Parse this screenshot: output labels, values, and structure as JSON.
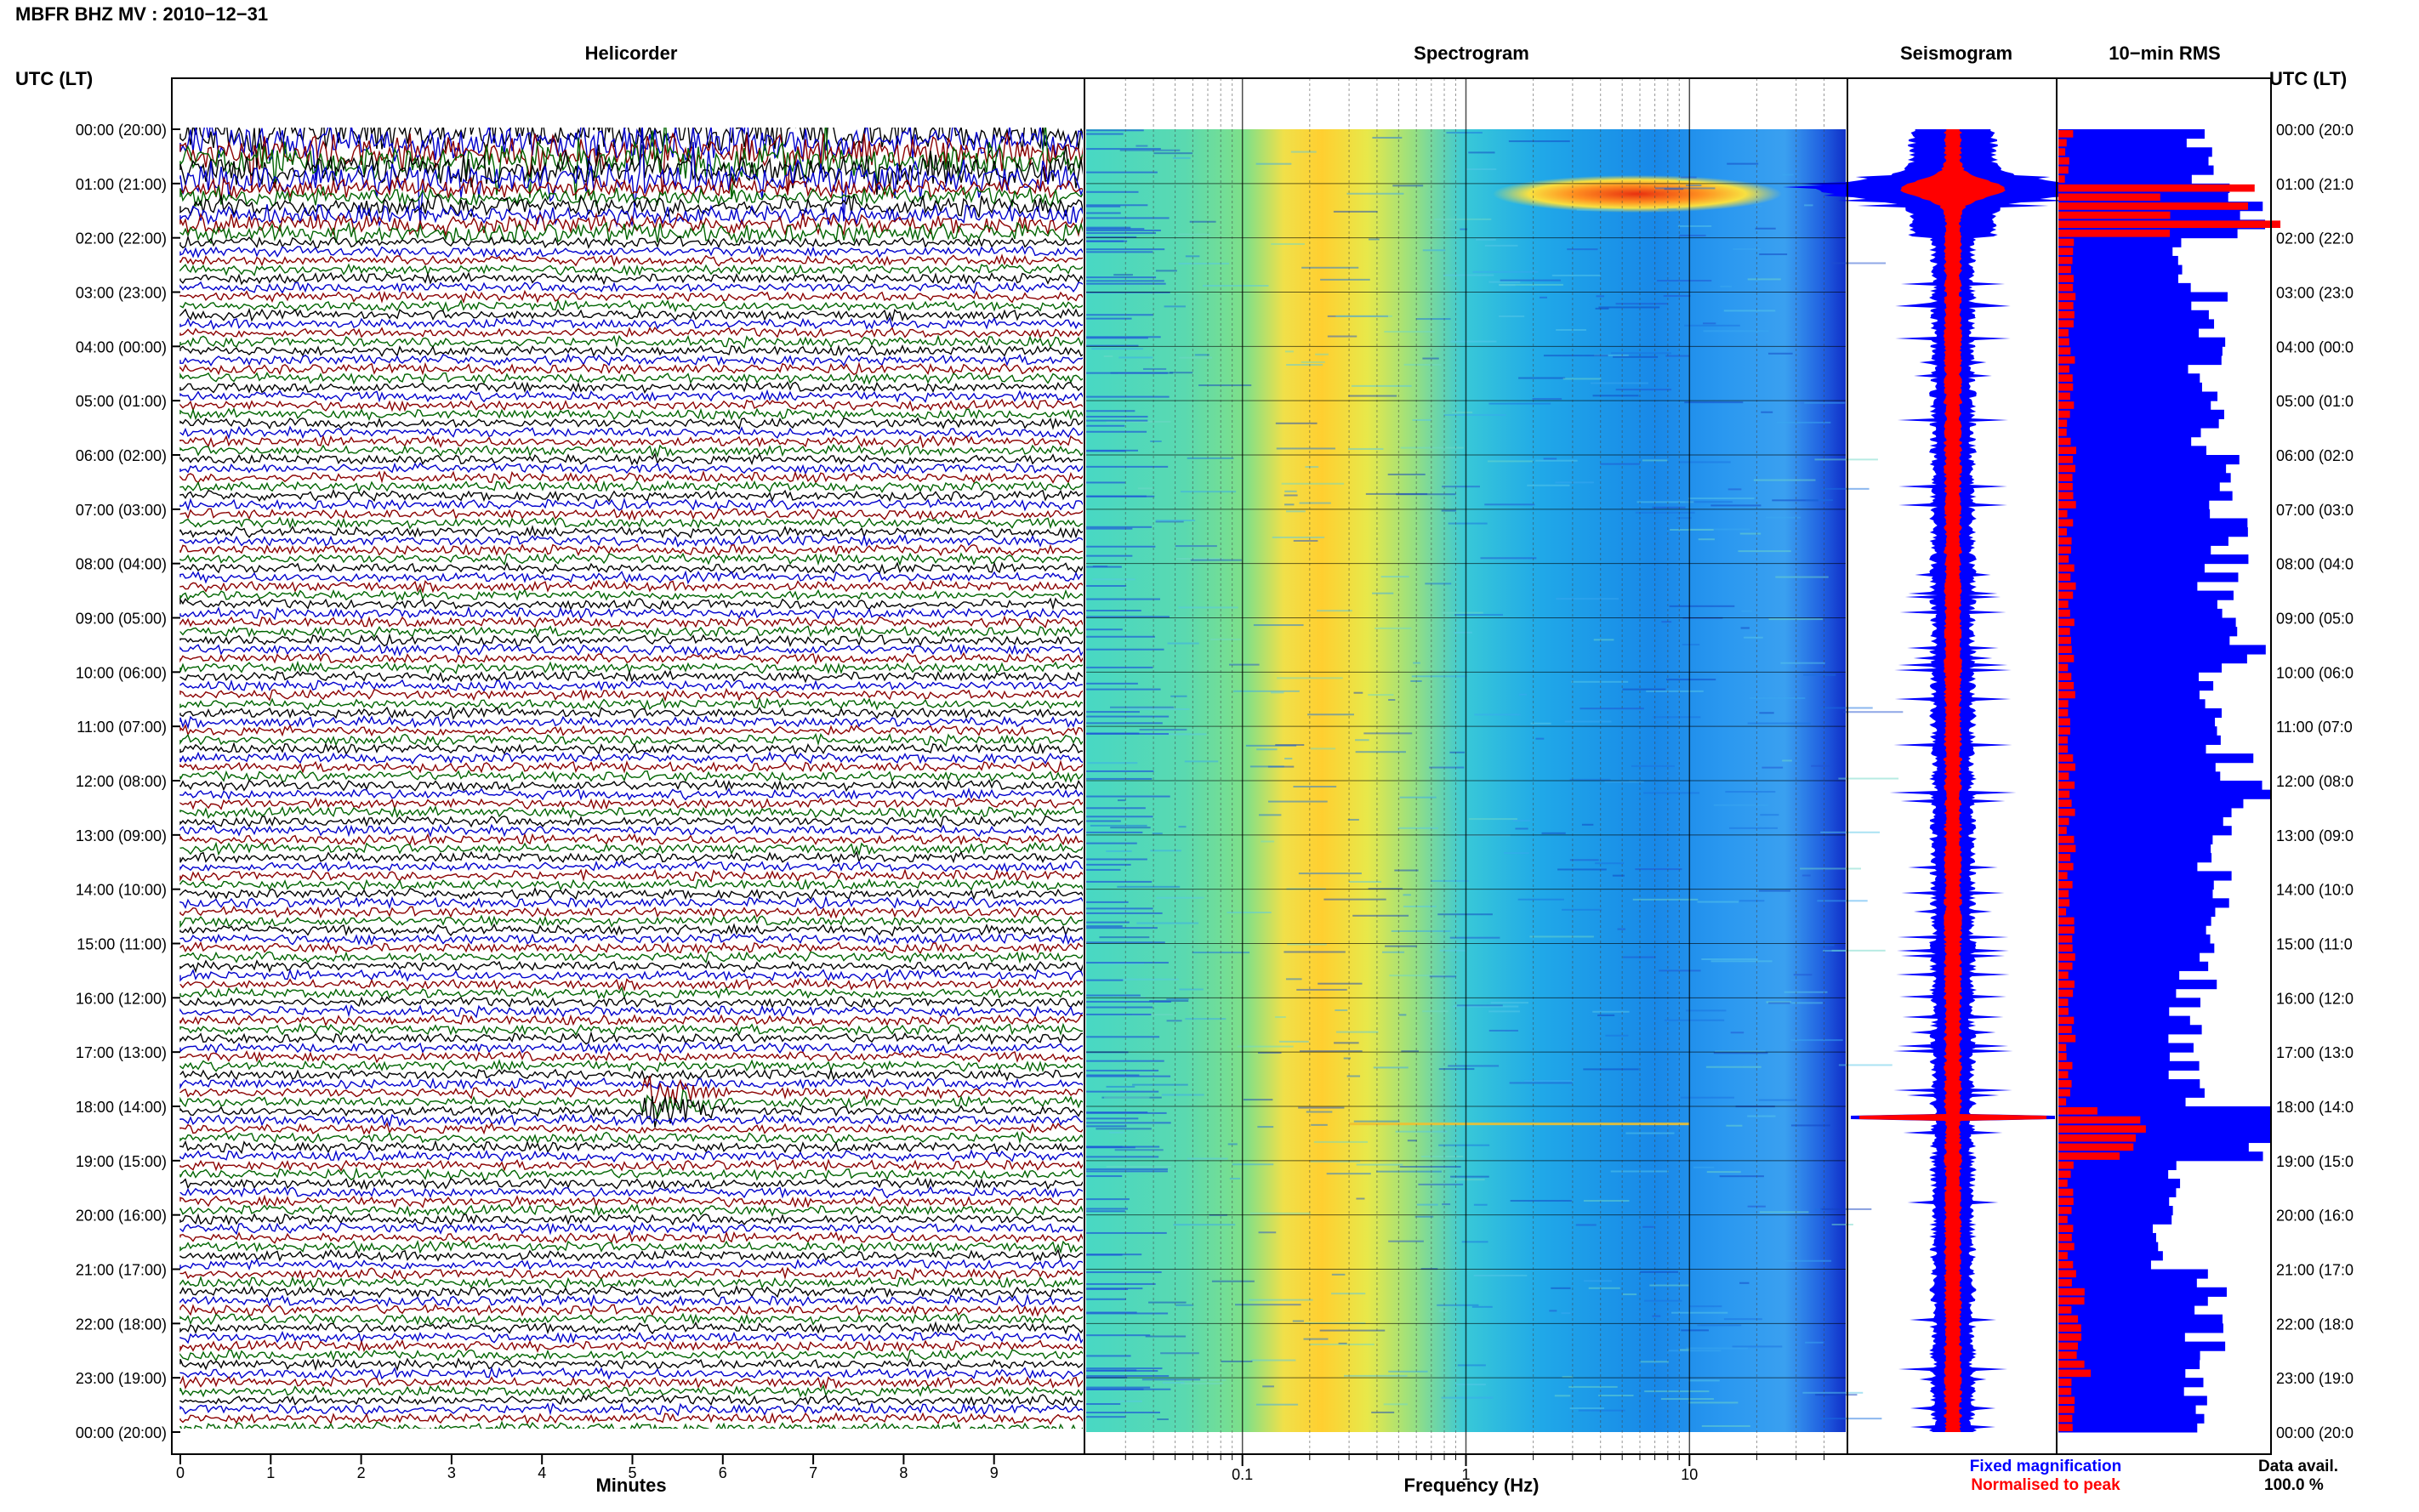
{
  "title": "MBFR BHZ MV : 2010−12−31",
  "left_axis_label": "UTC (LT)",
  "right_axis_label": "UTC (LT)",
  "panels": {
    "helicorder": "Helicorder",
    "spectrogram": "Spectrogram",
    "seismogram": "Seismogram",
    "rms": "10−min RMS"
  },
  "time_labels": [
    "00:00 (20:00)",
    "01:00 (21:00)",
    "02:00 (22:00)",
    "03:00 (23:00)",
    "04:00 (00:00)",
    "05:00 (01:00)",
    "06:00 (02:00)",
    "07:00 (03:00)",
    "08:00 (04:00)",
    "09:00 (05:00)",
    "10:00 (06:00)",
    "11:00 (07:00)",
    "12:00 (08:00)",
    "13:00 (09:00)",
    "14:00 (10:00)",
    "15:00 (11:00)",
    "16:00 (12:00)",
    "17:00 (13:00)",
    "18:00 (14:00)",
    "19:00 (15:00)",
    "20:00 (16:00)",
    "21:00 (17:00)",
    "22:00 (18:00)",
    "23:00 (19:00)",
    "00:00 (20:00)"
  ],
  "right_time_labels": [
    "00:00 (20:0",
    "01:00 (21:0",
    "02:00 (22:0",
    "03:00 (23:0",
    "04:00 (00:0",
    "05:00 (01:0",
    "06:00 (02:0",
    "07:00 (03:0",
    "08:00 (04:0",
    "09:00 (05:0",
    "10:00 (06:0",
    "11:00 (07:0",
    "12:00 (08:0",
    "13:00 (09:0",
    "14:00 (10:0",
    "15:00 (11:0",
    "16:00 (12:0",
    "17:00 (13:0",
    "18:00 (14:0",
    "19:00 (15:0",
    "20:00 (16:0",
    "21:00 (17:0",
    "22:00 (18:0",
    "23:00 (19:0",
    "00:00 (20:0"
  ],
  "legend": {
    "fixed": "Fixed magnification",
    "normalised": "Normalised to peak",
    "data_avail_label": "Data avail.",
    "data_avail_value": "100.0 %"
  },
  "colors": {
    "trace_colors": [
      "#000000",
      "#0000cc",
      "#8b0000",
      "#006400"
    ],
    "fixed_mag": "#0000ff",
    "normalised": "#ff0000"
  },
  "chart_data": [
    {
      "type": "line",
      "panel": "helicorder",
      "xlabel": "Minutes",
      "x_ticks": [
        0,
        1,
        2,
        3,
        4,
        5,
        6,
        7,
        8,
        9
      ],
      "xlim": [
        0,
        10
      ],
      "lines_per_hour": 6,
      "events": [
        {
          "hour": 0.0,
          "description_level": "high",
          "note": "strong noise 00:00-01:00"
        },
        {
          "hour": 1.0,
          "description_level": "high"
        },
        {
          "hour": 17.8,
          "minute": 5.1,
          "level": "event"
        }
      ]
    },
    {
      "type": "heatmap",
      "panel": "spectrogram",
      "xlabel": "Frequency (Hz)",
      "x_scale": "log",
      "xlim": [
        0.02,
        50
      ],
      "x_ticks": [
        0.1,
        1,
        10
      ],
      "x_tick_labels": [
        "0.1",
        "1",
        "10"
      ],
      "colormap": "jet",
      "peak_band_hz": [
        0.2,
        0.5
      ],
      "event_band": {
        "hour": 1.1,
        "freq_range_hz": [
          2,
          12
        ]
      }
    },
    {
      "type": "area",
      "panel": "seismogram",
      "series": [
        {
          "name": "Fixed magnification",
          "color": "#0000ff"
        },
        {
          "name": "Normalised to peak",
          "color": "#ff0000"
        }
      ],
      "peak_hours": [
        1.1,
        18.2
      ]
    },
    {
      "type": "bar",
      "panel": "rms",
      "orientation": "horizontal",
      "bins_per_hour": 6,
      "series": [
        {
          "name": "Fixed magnification",
          "color": "#0000ff"
        },
        {
          "name": "Normalised to peak",
          "color": "#ff0000"
        }
      ],
      "hourly_fixed": [
        0.7,
        0.9,
        0.55,
        0.7,
        0.7,
        0.7,
        0.78,
        0.8,
        0.75,
        0.85,
        0.75,
        0.8,
        0.9,
        0.75,
        0.7,
        0.65,
        0.6,
        0.6,
        1.0,
        0.55,
        0.5,
        0.75,
        0.7,
        0.65
      ],
      "hourly_norm": [
        0.05,
        0.75,
        0.08,
        0.06,
        0.06,
        0.06,
        0.06,
        0.06,
        0.06,
        0.06,
        0.06,
        0.06,
        0.06,
        0.06,
        0.06,
        0.06,
        0.06,
        0.06,
        0.3,
        0.06,
        0.06,
        0.1,
        0.12,
        0.08
      ]
    }
  ]
}
